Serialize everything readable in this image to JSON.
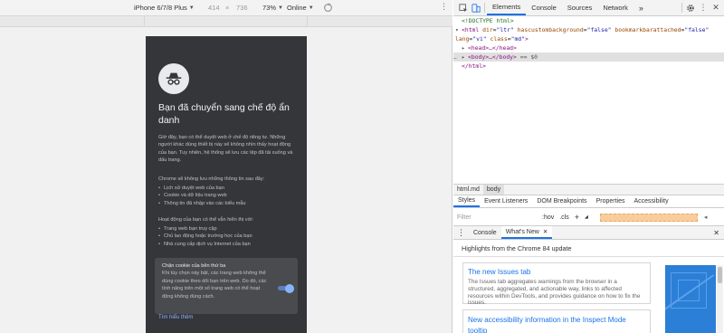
{
  "device_toolbar": {
    "device": "iPhone 6/7/8 Plus",
    "width": "414",
    "separator": "×",
    "height": "736",
    "zoom": "73%",
    "network": "Online"
  },
  "phone": {
    "title": "Bạn đã chuyển sang chế độ ẩn danh",
    "intro": "Giờ đây, bạn có thể duyệt web ở chế độ riêng tư. Những người khác dùng thiết bị này sẽ không nhìn thấy hoạt động của bạn. Tuy nhiên, hệ thống sẽ lưu các tệp đã tải xuống và dấu trang.",
    "not_saved_heading": "Chrome sẽ không lưu những thông tin sau đây:",
    "not_saved_items": [
      "Lịch sử duyệt web của bạn",
      "Cookie và dữ liệu trang web",
      "Thông tin đã nhập vào các biểu mẫu"
    ],
    "visible_heading": "Hoạt động của bạn có thể vẫn hiển thị với:",
    "visible_items": [
      "Trang web bạn truy cập",
      "Chủ lao động hoặc trường học của bạn",
      "Nhà cung cấp dịch vụ Internet của bạn"
    ],
    "cookie_title": "Chặn cookie của bên thứ ba",
    "cookie_text": "Khi tùy chọn này bật, các trang web không thể dùng cookie theo dõi bạn trên web. Do đó, các tính năng trên một số trang web có thể hoạt động không đúng cách.",
    "learn_more": "Tìm hiểu thêm"
  },
  "devtools": {
    "tabs": [
      "Elements",
      "Console",
      "Sources",
      "Network"
    ],
    "more": "»",
    "elements": {
      "doctype": "<!DOCTYPE html>",
      "html_open_tag": "<html",
      "attr_dir": "dir",
      "attr_dir_val": "\"ltr\"",
      "attr_bg": "hascustombackground",
      "attr_bg_val": "\"false\"",
      "attr_bm": "bookmarkbarattached",
      "attr_bm_val": "\"false\"",
      "attr_lang": "lang",
      "attr_lang_val": "\"vi\"",
      "attr_class": "class",
      "attr_class_val": "\"md\"",
      "html_close_bracket": ">",
      "head": "<head>…</head>",
      "body": "<body>…</body>",
      "body_suffix": "== $0",
      "html_close": "</html>"
    },
    "breadcrumbs": [
      "html.md",
      "body"
    ],
    "subtabs": [
      "Styles",
      "Event Listeners",
      "DOM Breakpoints",
      "Properties",
      "Accessibility"
    ],
    "filter_placeholder": "Filter",
    "filter_options": [
      ":hov",
      ".cls",
      "+"
    ],
    "drawer_tabs": [
      "Console",
      "What's New"
    ],
    "whats_new": {
      "heading": "Highlights from the Chrome 84 update",
      "cards": [
        {
          "title": "The new Issues tab",
          "desc": "The Issues tab aggregates warnings from the browser in a structured, aggregated, and actionable way, links to affected resources within DevTools, and provides guidance on how to fix the issues."
        },
        {
          "title": "New accessibility information in the Inspect Mode tooltip",
          "desc": ""
        }
      ]
    }
  }
}
